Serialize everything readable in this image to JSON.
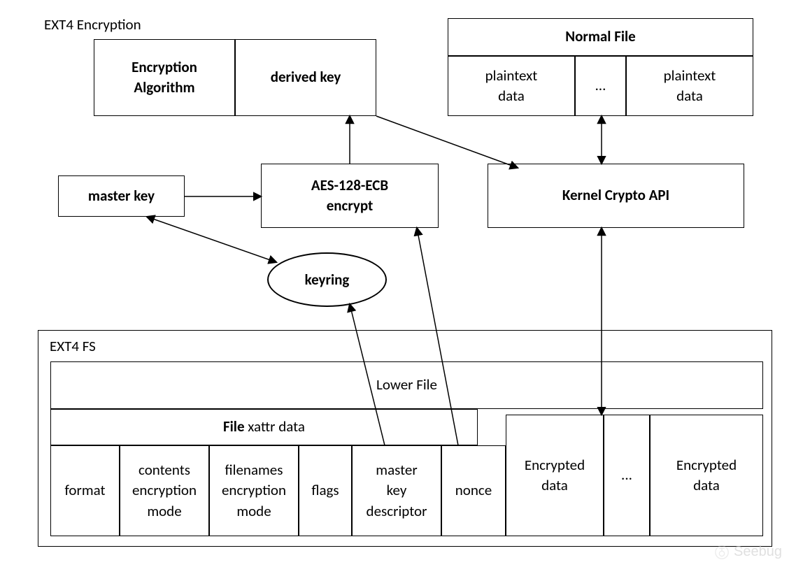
{
  "title": "EXT4 Encryption",
  "top_left_box": {
    "left_label": "Encryption\nAlgorithm",
    "right_label": "derived key"
  },
  "normal_file": {
    "title": "Normal File",
    "cell1": "plaintext\ndata",
    "cell_mid": "…",
    "cell3": "plaintext\ndata"
  },
  "master_key": "master key",
  "aes_box": "AES-128-ECB\nencrypt",
  "kernel_crypto": "Kernel Crypto API",
  "keyring": "keyring",
  "ext4fs": {
    "title": "EXT4 FS",
    "lower_file": "Lower File",
    "xattr_label": "File xattr data",
    "cols": {
      "format": "format",
      "contents": "contents\nencryption\nmode",
      "filenames": "filenames\nencryption\nmode",
      "flags": "flags",
      "mkd": "master\nkey\ndescriptor",
      "nonce": "nonce",
      "enc1": "Encrypted\ndata",
      "dots": "...",
      "enc2": "Encrypted\ndata"
    }
  },
  "watermark": "Seebug"
}
